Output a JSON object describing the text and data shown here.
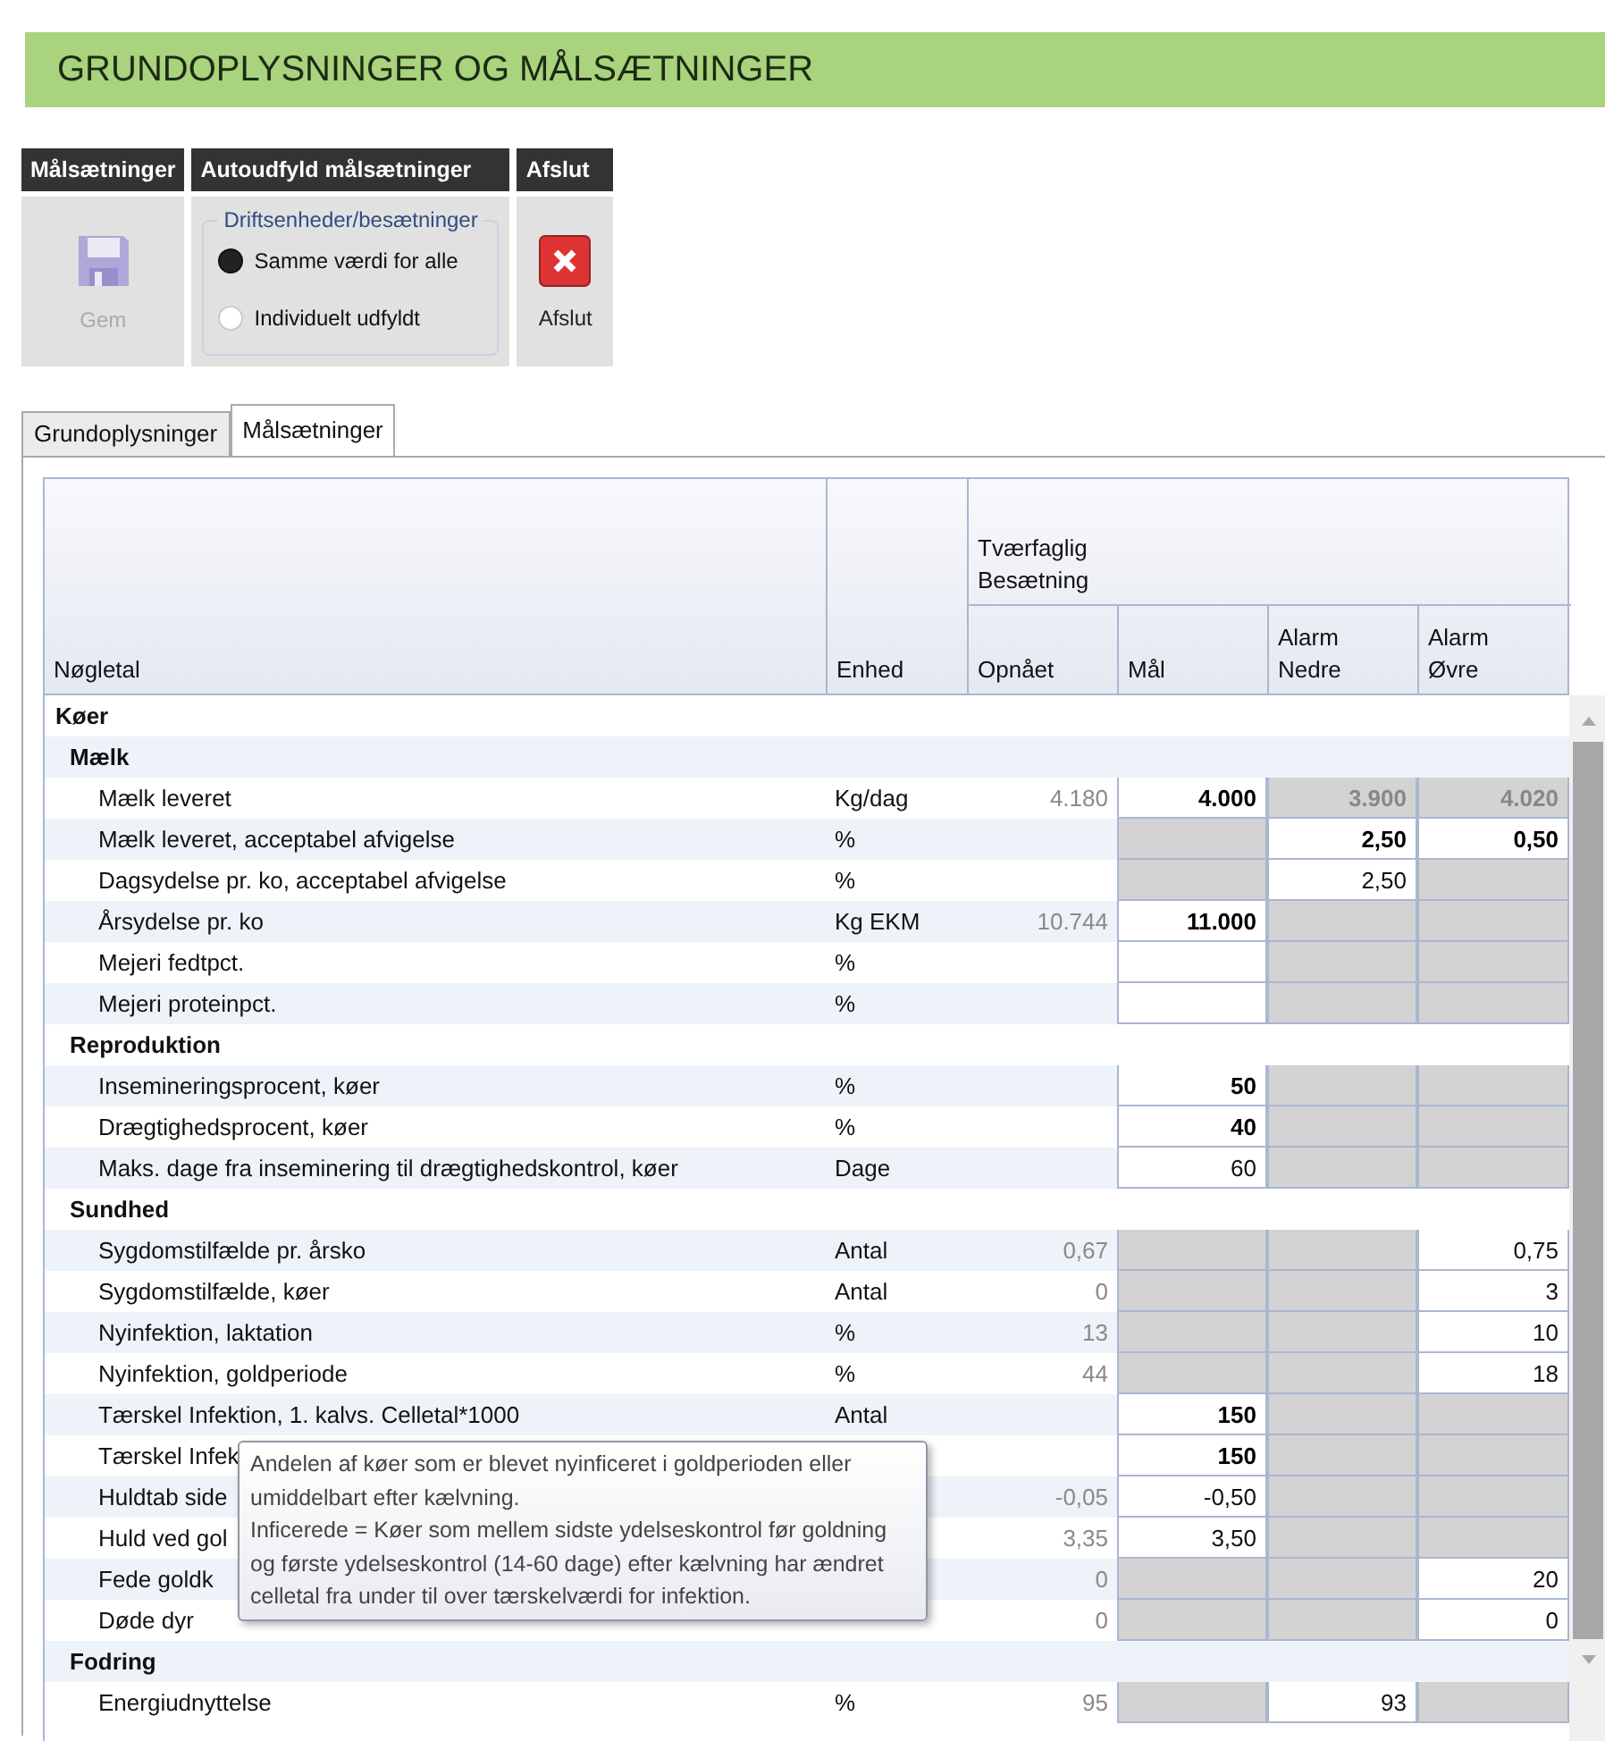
{
  "page_title": "GRUNDOPLYSNINGER OG MÅLSÆTNINGER",
  "ribbon": {
    "groups": [
      {
        "kind": "save",
        "header": "Målsætninger",
        "button": {
          "label": "Gem",
          "disabled": true
        }
      },
      {
        "kind": "radio",
        "header": "Autoudfyld målsætninger",
        "legend": "Driftsenheder/besætninger",
        "options": [
          {
            "label": "Samme værdi for alle",
            "selected": true
          },
          {
            "label": "Individuelt udfyldt",
            "selected": false
          }
        ]
      },
      {
        "kind": "close",
        "header": "Afslut",
        "button": {
          "label": "Afslut",
          "disabled": false
        }
      }
    ]
  },
  "tabs": [
    {
      "label": "Grundoplysninger",
      "selected": false
    },
    {
      "label": "Målsætninger",
      "selected": true
    }
  ],
  "table": {
    "columns": {
      "name": "Nøgletal",
      "unit": "Enhed",
      "group": [
        "Tværfaglig",
        "Besætning"
      ],
      "achieved": "Opnået",
      "goal": "Mål",
      "alarm_low": [
        "Alarm",
        "Nedre"
      ],
      "alarm_high": [
        "Alarm",
        "Øvre"
      ]
    },
    "groups": [
      {
        "label": "Køer",
        "children": [
          {
            "label": "Mælk",
            "rows": [
              {
                "name": "Mælk leveret",
                "unit": "Kg/dag",
                "cells": [
                  {
                    "kind": "plain",
                    "value": "4.180"
                  },
                  {
                    "kind": "input",
                    "value": "4.000",
                    "bold": true
                  },
                  {
                    "kind": "locked",
                    "value": "3.900",
                    "bold": true
                  },
                  {
                    "kind": "locked",
                    "value": "4.020",
                    "bold": true
                  }
                ]
              },
              {
                "name": "Mælk leveret, acceptabel afvigelse",
                "unit": "%",
                "cells": [
                  {
                    "kind": "plain"
                  },
                  {
                    "kind": "locked"
                  },
                  {
                    "kind": "input",
                    "value": "2,50",
                    "bold": true
                  },
                  {
                    "kind": "input",
                    "value": "0,50",
                    "bold": true
                  }
                ]
              },
              {
                "name": "Dagsydelse pr. ko, acceptabel afvigelse",
                "unit": "%",
                "cells": [
                  {
                    "kind": "plain"
                  },
                  {
                    "kind": "locked"
                  },
                  {
                    "kind": "input",
                    "value": "2,50"
                  },
                  {
                    "kind": "locked"
                  }
                ]
              },
              {
                "name": "Årsydelse pr. ko",
                "unit": "Kg EKM",
                "cells": [
                  {
                    "kind": "plain",
                    "value": "10.744"
                  },
                  {
                    "kind": "input",
                    "value": "11.000",
                    "bold": true
                  },
                  {
                    "kind": "locked"
                  },
                  {
                    "kind": "locked"
                  }
                ]
              },
              {
                "name": "Mejeri fedtpct.",
                "unit": "%",
                "cells": [
                  {
                    "kind": "plain"
                  },
                  {
                    "kind": "input"
                  },
                  {
                    "kind": "locked"
                  },
                  {
                    "kind": "locked"
                  }
                ]
              },
              {
                "name": "Mejeri proteinpct.",
                "unit": "%",
                "cells": [
                  {
                    "kind": "plain"
                  },
                  {
                    "kind": "input"
                  },
                  {
                    "kind": "locked"
                  },
                  {
                    "kind": "locked"
                  }
                ]
              }
            ]
          },
          {
            "label": "Reproduktion",
            "rows": [
              {
                "name": "Insemineringsprocent, køer",
                "unit": "%",
                "cells": [
                  {
                    "kind": "plain"
                  },
                  {
                    "kind": "input",
                    "value": "50",
                    "bold": true
                  },
                  {
                    "kind": "locked"
                  },
                  {
                    "kind": "locked"
                  }
                ]
              },
              {
                "name": "Drægtighedsprocent, køer",
                "unit": "%",
                "cells": [
                  {
                    "kind": "plain"
                  },
                  {
                    "kind": "input",
                    "value": "40",
                    "bold": true
                  },
                  {
                    "kind": "locked"
                  },
                  {
                    "kind": "locked"
                  }
                ]
              },
              {
                "name": "Maks. dage fra inseminering til drægtighedskontrol, køer",
                "unit": "Dage",
                "cells": [
                  {
                    "kind": "plain"
                  },
                  {
                    "kind": "input",
                    "value": "60"
                  },
                  {
                    "kind": "locked"
                  },
                  {
                    "kind": "locked"
                  }
                ]
              }
            ]
          },
          {
            "label": "Sundhed",
            "rows": [
              {
                "name": "Sygdomstilfælde pr. årsko",
                "unit": "Antal",
                "cells": [
                  {
                    "kind": "plain",
                    "value": "0,67"
                  },
                  {
                    "kind": "locked"
                  },
                  {
                    "kind": "locked"
                  },
                  {
                    "kind": "input",
                    "value": "0,75"
                  }
                ]
              },
              {
                "name": "Sygdomstilfælde, køer",
                "unit": "Antal",
                "cells": [
                  {
                    "kind": "plain",
                    "value": "0"
                  },
                  {
                    "kind": "locked"
                  },
                  {
                    "kind": "locked"
                  },
                  {
                    "kind": "input",
                    "value": "3"
                  }
                ]
              },
              {
                "name": "Nyinfektion, laktation",
                "unit": "%",
                "cells": [
                  {
                    "kind": "plain",
                    "value": "13"
                  },
                  {
                    "kind": "locked"
                  },
                  {
                    "kind": "locked"
                  },
                  {
                    "kind": "input",
                    "value": "10"
                  }
                ]
              },
              {
                "name": "Nyinfektion, goldperiode",
                "unit": "%",
                "cells": [
                  {
                    "kind": "plain",
                    "value": "44"
                  },
                  {
                    "kind": "locked"
                  },
                  {
                    "kind": "locked"
                  },
                  {
                    "kind": "input",
                    "value": "18"
                  }
                ]
              },
              {
                "name": "Tærskel Infektion, 1. kalvs. Celletal*1000",
                "unit": "Antal",
                "cells": [
                  {
                    "kind": "plain"
                  },
                  {
                    "kind": "input",
                    "value": "150",
                    "bold": true
                  },
                  {
                    "kind": "locked"
                  },
                  {
                    "kind": "locked"
                  }
                ]
              },
              {
                "name": "Tærskel Infek",
                "cells": [
                  {
                    "kind": "plain"
                  },
                  {
                    "kind": "input",
                    "value": "150",
                    "bold": true
                  },
                  {
                    "kind": "locked"
                  },
                  {
                    "kind": "locked"
                  }
                ]
              },
              {
                "name": "Huldtab side",
                "cells": [
                  {
                    "kind": "plain",
                    "value": "-0,05"
                  },
                  {
                    "kind": "input",
                    "value": "-0,50"
                  },
                  {
                    "kind": "locked"
                  },
                  {
                    "kind": "locked"
                  }
                ]
              },
              {
                "name": "Huld ved gol",
                "cells": [
                  {
                    "kind": "plain",
                    "value": "3,35"
                  },
                  {
                    "kind": "input",
                    "value": "3,50"
                  },
                  {
                    "kind": "locked"
                  },
                  {
                    "kind": "locked"
                  }
                ]
              },
              {
                "name": "Fede goldk",
                "cells": [
                  {
                    "kind": "plain",
                    "value": "0"
                  },
                  {
                    "kind": "locked"
                  },
                  {
                    "kind": "locked"
                  },
                  {
                    "kind": "input",
                    "value": "20"
                  }
                ]
              },
              {
                "name": "Døde dyr",
                "cells": [
                  {
                    "kind": "plain",
                    "value": "0"
                  },
                  {
                    "kind": "locked"
                  },
                  {
                    "kind": "locked"
                  },
                  {
                    "kind": "input",
                    "value": "0"
                  }
                ]
              }
            ]
          },
          {
            "label": "Fodring",
            "rows": [
              {
                "name": "Energiudnyttelse",
                "unit": "%",
                "cells": [
                  {
                    "kind": "plain",
                    "value": "95"
                  },
                  {
                    "kind": "locked"
                  },
                  {
                    "kind": "input",
                    "value": "93"
                  },
                  {
                    "kind": "locked"
                  }
                ]
              }
            ]
          }
        ]
      }
    ]
  },
  "tooltip": [
    "Andelen af køer som er blevet nyinficeret i goldperioden eller umiddelbart efter kælvning.",
    "Inficerede = Køer som mellem sidste ydelseskontrol før goldning og første ydelseskontrol (14-60 dage) efter kælvning har ændret celletal fra under til over tærskelværdi for infektion."
  ]
}
